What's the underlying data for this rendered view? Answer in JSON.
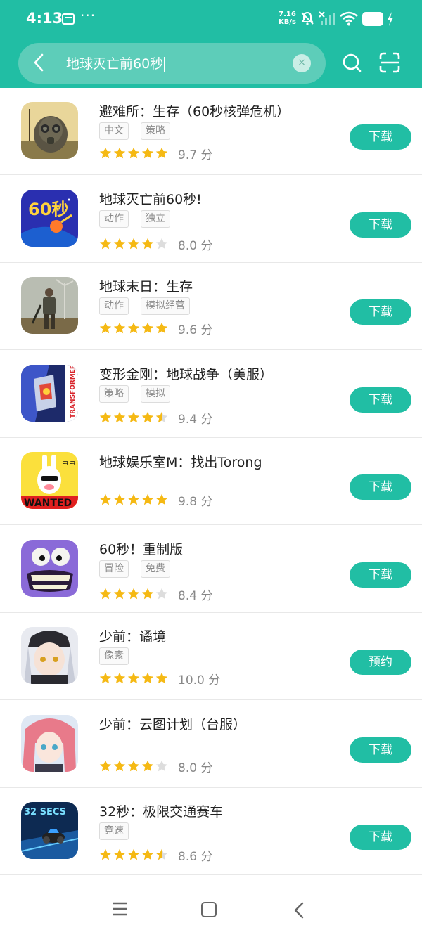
{
  "status_bar": {
    "time": "4:13",
    "dots": "···",
    "speed_value": "7.16",
    "speed_unit": "KB/s",
    "battery": "97"
  },
  "search": {
    "query": "地球灭亡前60秒",
    "clear_symbol": "×"
  },
  "colors": {
    "accent": "#21bea4",
    "star_filled": "#f5b914",
    "star_empty": "#dddddd"
  },
  "apps": [
    {
      "name": "避难所：生存（60秒核弹危机）",
      "tags": [
        "中文",
        "策略"
      ],
      "rating": 5,
      "score": "9.7 分",
      "button": "下载"
    },
    {
      "name": "地球灭亡前60秒!",
      "tags": [
        "动作",
        "独立"
      ],
      "rating": 4,
      "score": "8.0 分",
      "button": "下载"
    },
    {
      "name": "地球末日：生存",
      "tags": [
        "动作",
        "模拟经营"
      ],
      "rating": 5,
      "score": "9.6 分",
      "button": "下载"
    },
    {
      "name": "变形金刚：地球战争（美服）",
      "tags": [
        "策略",
        "模拟"
      ],
      "rating": 4.5,
      "score": "9.4 分",
      "button": "下载"
    },
    {
      "name": "地球娱乐室M：找出Torong",
      "tags": [],
      "rating": 5,
      "score": "9.8 分",
      "button": "下载"
    },
    {
      "name": "60秒！重制版",
      "tags": [
        "冒险",
        "免费"
      ],
      "rating": 4,
      "score": "8.4 分",
      "button": "下载"
    },
    {
      "name": "少前：谲境",
      "tags": [
        "像素"
      ],
      "rating": 5,
      "score": "10.0 分",
      "button": "预约"
    },
    {
      "name": "少前：云图计划（台服）",
      "tags": [],
      "rating": 4,
      "score": "8.0 分",
      "button": "下载"
    },
    {
      "name": "32秒：极限交通赛车",
      "tags": [
        "竞速"
      ],
      "rating": 4.5,
      "score": "8.6 分",
      "button": "下载"
    }
  ]
}
